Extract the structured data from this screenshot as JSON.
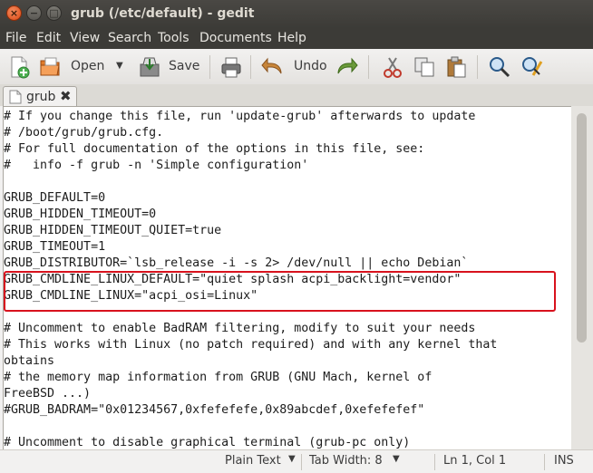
{
  "window": {
    "title": "grub (/etc/default) - gedit"
  },
  "menu": [
    "File",
    "Edit",
    "View",
    "Search",
    "Tools",
    "Documents",
    "Help"
  ],
  "toolbar": {
    "open_label": "Open",
    "save_label": "Save",
    "undo_label": "Undo",
    "icons": [
      "new-document-icon",
      "open-icon",
      "save-icon",
      "print-icon",
      "undo-icon",
      "redo-icon",
      "cut-icon",
      "copy-icon",
      "paste-icon",
      "find-icon",
      "replace-icon"
    ]
  },
  "tab": {
    "label": "grub"
  },
  "editor": {
    "lines": [
      "# If you change this file, run 'update-grub' afterwards to update",
      "# /boot/grub/grub.cfg.",
      "# For full documentation of the options in this file, see:",
      "#   info -f grub -n 'Simple configuration'",
      "",
      "GRUB_DEFAULT=0",
      "GRUB_HIDDEN_TIMEOUT=0",
      "GRUB_HIDDEN_TIMEOUT_QUIET=true",
      "GRUB_TIMEOUT=1",
      "GRUB_DISTRIBUTOR=`lsb_release -i -s 2> /dev/null || echo Debian`",
      "GRUB_CMDLINE_LINUX_DEFAULT=\"quiet splash acpi_backlight=vendor\"",
      "GRUB_CMDLINE_LINUX=\"acpi_osi=Linux\"",
      "",
      "# Uncomment to enable BadRAM filtering, modify to suit your needs",
      "# This works with Linux (no patch required) and with any kernel that",
      "obtains",
      "# the memory map information from GRUB (GNU Mach, kernel of",
      "FreeBSD ...)",
      "#GRUB_BADRAM=\"0x01234567,0xfefefefe,0x89abcdef,0xefefefef\"",
      "",
      "# Uncomment to disable graphical terminal (grub-pc only)"
    ]
  },
  "status": {
    "syntax": "Plain Text",
    "tab_width": "Tab Width: 8",
    "position": "Ln 1, Col 1",
    "mode": "INS"
  },
  "colors": {
    "highlight_border": "#d8121d",
    "titlebar": "#3c3b37",
    "close_button": "#dd4814"
  }
}
